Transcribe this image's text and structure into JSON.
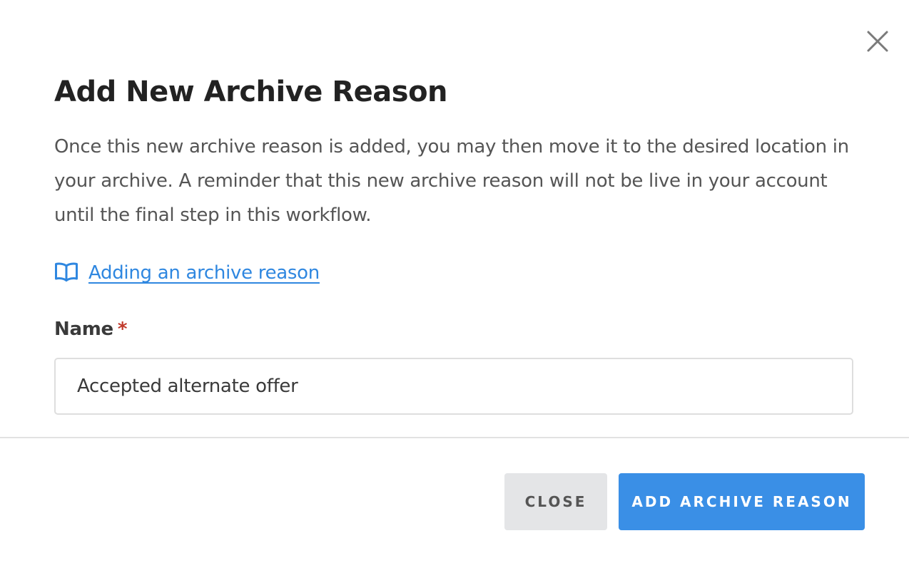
{
  "modal": {
    "title": "Add New Archive Reason",
    "description": "Once this new archive reason is added, you may then move it to the desired location in your archive. A reminder that this new archive reason will not be live in your account until the final step in this workflow.",
    "help_link": {
      "icon": "book-open-icon",
      "label": "Adding an archive reason"
    },
    "close_icon": "close-icon",
    "form": {
      "name_label": "Name",
      "required_marker": "*",
      "name_value": "Accepted alternate offer"
    },
    "buttons": {
      "close_label": "CLOSE",
      "add_label": "ADD ARCHIVE REASON"
    }
  },
  "colors": {
    "link": "#2f87e0",
    "primary_button": "#3a8fe6",
    "secondary_button": "#e4e5e7",
    "required": "#c0392b",
    "title": "#222222",
    "body_text": "#555555"
  }
}
